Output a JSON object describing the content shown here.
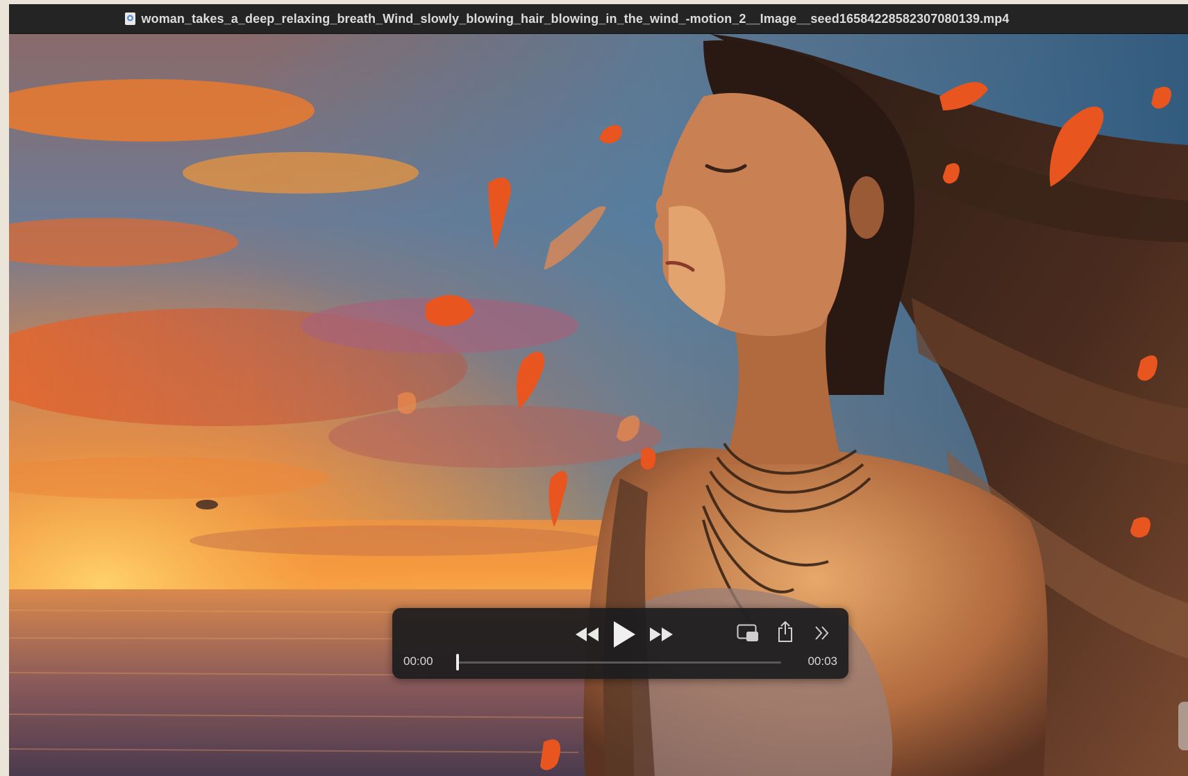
{
  "window": {
    "title": "woman_takes_a_deep_relaxing_breath_Wind_slowly_blowing_hair_blowing_in_the_wind_-motion_2__Image__seed1658422858230708013​9.mp4",
    "title_icon": "document-icon"
  },
  "player": {
    "current_time": "00:00",
    "total_time": "00:03",
    "progress": 0.0,
    "buttons": {
      "rewind": "rewind-icon",
      "play": "play-icon",
      "fast_forward": "fast-forward-icon",
      "picture_in_picture": "picture-in-picture-icon",
      "share": "share-icon",
      "more": "chevron-double-right-icon"
    }
  },
  "colors": {
    "titlebar_bg": "#242424",
    "controls_bg": "#1c1c1e",
    "sky_orange": "#f07a2a",
    "sky_blue": "#3c6e93"
  }
}
